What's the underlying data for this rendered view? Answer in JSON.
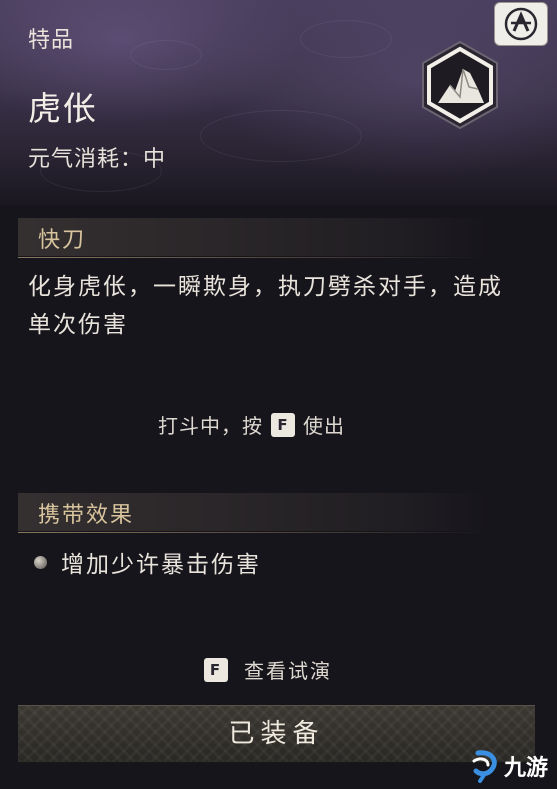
{
  "item": {
    "grade": "特品",
    "name": "虎伥",
    "cost_label": "元气消耗",
    "cost_value": "中"
  },
  "skill_section": {
    "title": "快刀",
    "description": "化身虎伥，一瞬欺身，执刀劈杀对手，造成单次伤害",
    "hint_before": "打斗中，按",
    "hint_key": "F",
    "hint_after": "使出"
  },
  "carry_section": {
    "title": "携带效果",
    "items": [
      {
        "text": "增加少许暴击伤害"
      }
    ]
  },
  "preview": {
    "key": "F",
    "label": "查看试演"
  },
  "equip_button": {
    "label": "已装备"
  },
  "watermark": {
    "text": "九游"
  },
  "icons": {
    "corner": "faction-emblem-icon",
    "emblem": "mountain-emblem-icon",
    "bullet": "bullet-dot-icon",
    "watermark_logo": "jiuyou-logo-icon"
  },
  "colors": {
    "section_title": "#d8c49d",
    "header_top": "#4a3f5e",
    "background": "#17151c",
    "watermark_logo": "#3a8fe0"
  }
}
